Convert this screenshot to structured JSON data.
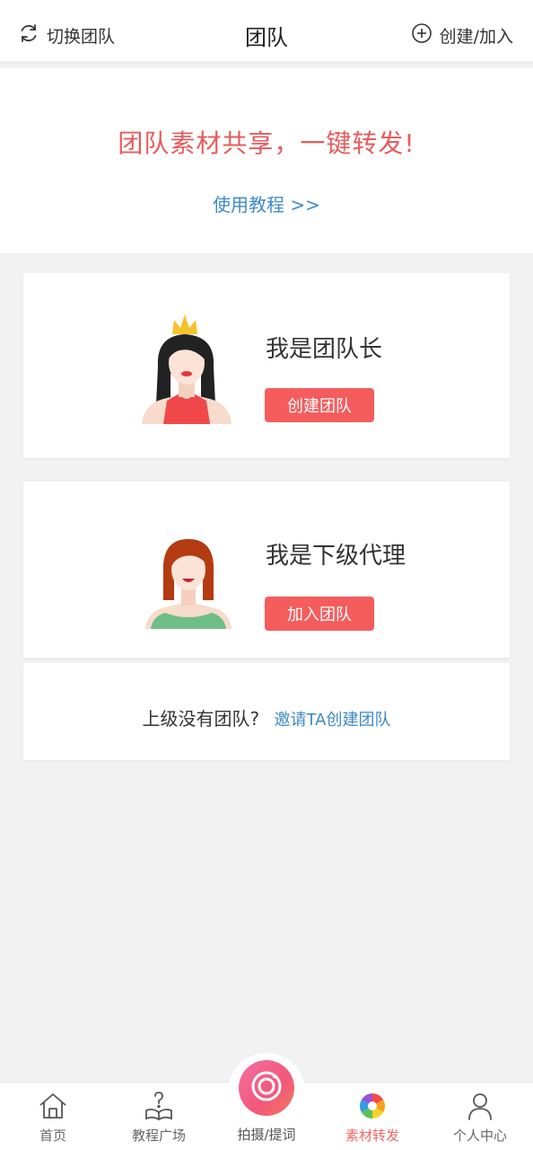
{
  "header": {
    "switch_label": "切换团队",
    "switch_icon": "refresh-icon",
    "title": "团队",
    "create_join_label": "创建/加入",
    "create_join_icon": "plus-circle-icon"
  },
  "banner": {
    "slogan": "团队素材共享，一键转发!",
    "tutorial_link": "使用教程 >>"
  },
  "leader_card": {
    "role": "我是团队长",
    "button": "创建团队",
    "avatar_icon": "crowned-woman-avatar"
  },
  "agent_card": {
    "role": "我是下级代理",
    "button": "加入团队",
    "avatar_icon": "woman-avatar"
  },
  "invite_card": {
    "question": "上级没有团队?",
    "invite_link": "邀请TA创建团队"
  },
  "tabbar": {
    "tabs": [
      {
        "label": "首页",
        "icon": "home-icon"
      },
      {
        "label": "教程广场",
        "icon": "book-question-icon"
      },
      {
        "label": "拍摄/提词",
        "icon": "camera-icon"
      },
      {
        "label": "素材转发",
        "icon": "colorful-aperture-icon"
      },
      {
        "label": "个人中心",
        "icon": "user-icon"
      }
    ],
    "active_index": 3
  },
  "colors": {
    "accent_red": "#f55c5c",
    "slogan_red": "#e85b5b",
    "link_blue": "#3d8ac9",
    "background": "#f2f2f2"
  }
}
